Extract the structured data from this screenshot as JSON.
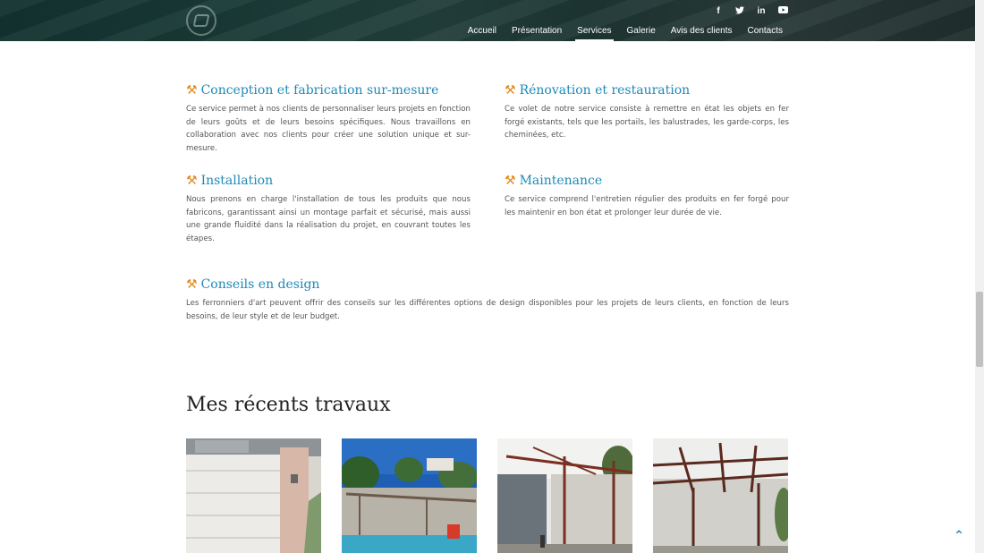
{
  "header": {
    "social": [
      {
        "icon": "facebook-icon",
        "glyph": "f"
      },
      {
        "icon": "twitter-icon",
        "glyph": "🐦"
      },
      {
        "icon": "linkedin-icon",
        "glyph": "in"
      },
      {
        "icon": "youtube-icon",
        "glyph": "▶"
      }
    ],
    "nav": [
      {
        "label": "Accueil",
        "active": false
      },
      {
        "label": "Présentation",
        "active": false
      },
      {
        "label": "Services",
        "active": true
      },
      {
        "label": "Galerie",
        "active": false
      },
      {
        "label": "Avis des clients",
        "active": false
      },
      {
        "label": "Contacts",
        "active": false
      }
    ]
  },
  "services": {
    "conception": {
      "title": "Conception et fabrication sur-mesure",
      "text": "Ce service permet à nos clients de personnaliser leurs projets en fonction de leurs goûts et de leurs besoins spécifiques. Nous travaillons en collaboration avec nos clients pour créer une solution unique et sur-mesure."
    },
    "renovation": {
      "title": "Rénovation et restauration",
      "text": "Ce volet de notre service consiste à remettre en état les objets en fer forgé existants, tels que les portails, les balustrades, les garde-corps, les cheminées, etc."
    },
    "installation": {
      "title": "Installation",
      "text": "Nous prenons en charge l'installation de tous les produits que nous fabricons, garantissant ainsi un montage parfait et sécurisé, mais aussi une grande fluidité dans la réalisation du projet, en couvrant toutes les étapes."
    },
    "maintenance": {
      "title": "Maintenance",
      "text": "Ce service comprend l'entretien régulier des produits en fer forgé pour les maintenir en bon état et prolonger leur durée de vie."
    },
    "conseils": {
      "title": "Conseils en design",
      "text": "Les ferronniers d'art peuvent offrir des conseils sur les différentes options de design disponibles pour les projets de leurs clients, en fonction de leurs besoins, de leur style et de leur budget."
    }
  },
  "works": {
    "title": "Mes récents travaux"
  },
  "icons": {
    "tool": "⚒",
    "back_to_top": "⌃"
  },
  "colors": {
    "accent": "#1e8ab8",
    "tool_icon": "#e08a1e"
  }
}
